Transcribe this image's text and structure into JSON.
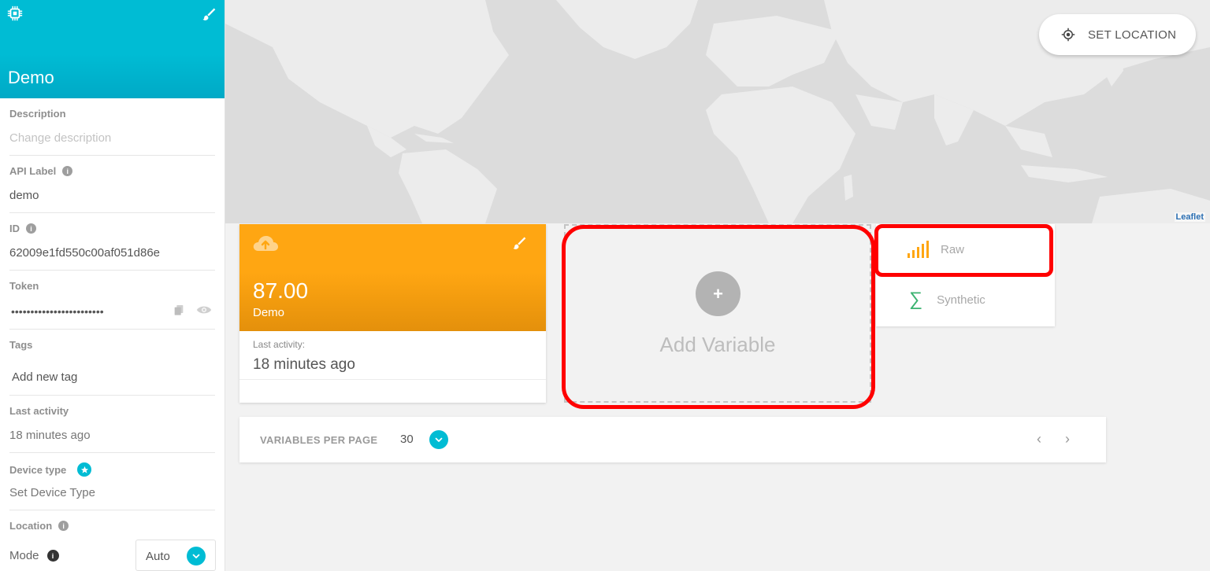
{
  "device": {
    "title": "Demo"
  },
  "sidebar": {
    "description_label": "Description",
    "description_placeholder": "Change description",
    "api_label_label": "API Label",
    "api_label_value": "demo",
    "id_label": "ID",
    "id_value": "62009e1fd550c00af051d86e",
    "token_label": "Token",
    "token_value": "••••••••••••••••••••••••",
    "tags_label": "Tags",
    "tags_placeholder": "Add new tag",
    "last_activity_label": "Last activity",
    "last_activity_value": "18 minutes ago",
    "device_type_label": "Device type",
    "device_type_value": "Set Device Type",
    "location_label": "Location",
    "mode_label": "Mode",
    "mode_value": "Auto"
  },
  "map": {
    "set_location_label": "SET LOCATION",
    "attribution": "Leaflet"
  },
  "variable_card": {
    "value": "87.00",
    "name": "Demo",
    "last_activity_label": "Last activity:",
    "last_activity_value": "18 minutes ago"
  },
  "add_variable": {
    "plus": "+",
    "label": "Add Variable"
  },
  "variable_type_menu": {
    "items": [
      {
        "label": "Raw",
        "icon": "signal-bars-icon"
      },
      {
        "label": "Synthetic",
        "icon": "sigma-icon"
      }
    ]
  },
  "pagination": {
    "per_page_label": "VARIABLES PER PAGE",
    "per_page_value": "30",
    "prev": "‹",
    "next": "›"
  },
  "colors": {
    "accent": "#00bcd4",
    "variable_card": "#ffa612",
    "highlight": "#ff0000",
    "synthetic_icon": "#3cb371"
  }
}
